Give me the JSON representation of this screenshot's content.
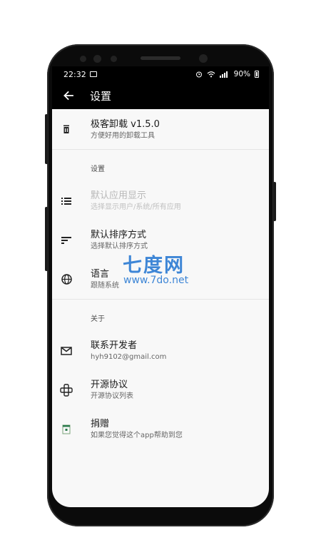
{
  "status": {
    "time": "22:32",
    "battery": "90%"
  },
  "toolbar": {
    "title": "设置"
  },
  "app_header": {
    "title": "极客卸载 v1.5.0",
    "subtitle": "方便好用的卸载工具"
  },
  "sections": {
    "settings_label": "设置",
    "about_label": "关于"
  },
  "settings_items": [
    {
      "title": "默认应用显示",
      "subtitle": "选择显示用户/系统/所有应用"
    },
    {
      "title": "默认排序方式",
      "subtitle": "选择默认排序方式"
    },
    {
      "title": "语言",
      "subtitle": "跟随系统"
    }
  ],
  "about_items": [
    {
      "title": "联系开发者",
      "subtitle": "hyh9102@gmail.com"
    },
    {
      "title": "开源协议",
      "subtitle": "开源协议列表"
    },
    {
      "title": "捐赠",
      "subtitle": "如果您觉得这个app帮助到您"
    }
  ],
  "watermark": {
    "cn": "七度网",
    "url": "www.7do.net"
  },
  "colors": {
    "toolbar": "#000000",
    "background": "#f8f8f8",
    "watermark": "#3e86d6"
  }
}
